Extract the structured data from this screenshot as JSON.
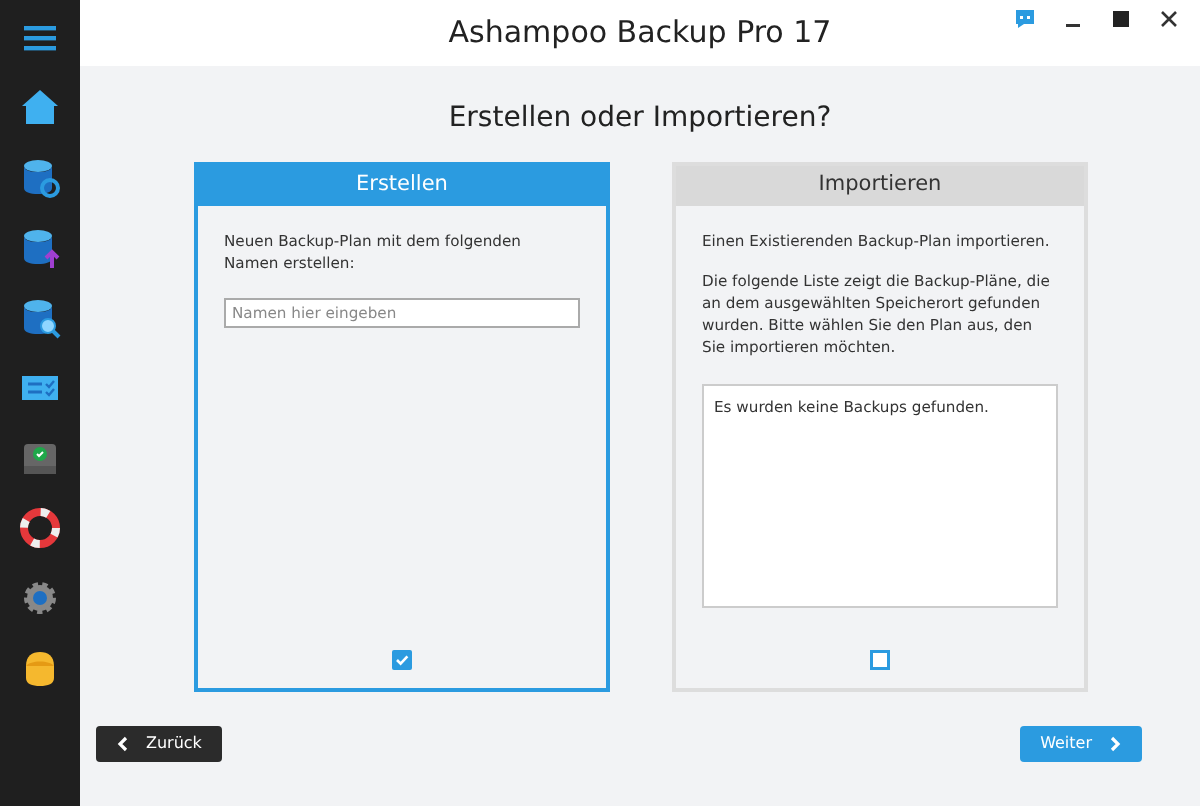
{
  "window": {
    "title": "Ashampoo Backup Pro 17"
  },
  "sidebar": {
    "items": [
      {
        "kind": "menu"
      },
      {
        "kind": "home"
      },
      {
        "kind": "db-refresh"
      },
      {
        "kind": "db-upload"
      },
      {
        "kind": "db-search"
      },
      {
        "kind": "checklist"
      },
      {
        "kind": "drive"
      },
      {
        "kind": "lifebuoy"
      },
      {
        "kind": "gear"
      },
      {
        "kind": "user"
      }
    ]
  },
  "heading": "Erstellen oder Importieren?",
  "panels": [
    {
      "title": "Erstellen",
      "selected": true,
      "checked": true,
      "paragraphs": [
        "Neuen Backup-Plan mit dem folgenden Namen erstellen:"
      ],
      "field": {
        "placeholder": "Namen hier eingeben"
      }
    },
    {
      "title": "Importieren",
      "selected": false,
      "checked": false,
      "paragraphs": [
        "Einen Existierenden Backup-Plan importieren.",
        "Die folgende Liste zeigt die Backup-Pläne, die an dem ausgewählten Speicherort gefunden wurden. Bitte wählen Sie den Plan aus, den Sie importieren möchten."
      ],
      "list": {
        "empty_text": "Es wurden keine Backups gefunden."
      }
    }
  ],
  "buttons": {
    "back": "Zurück",
    "next": "Weiter"
  }
}
